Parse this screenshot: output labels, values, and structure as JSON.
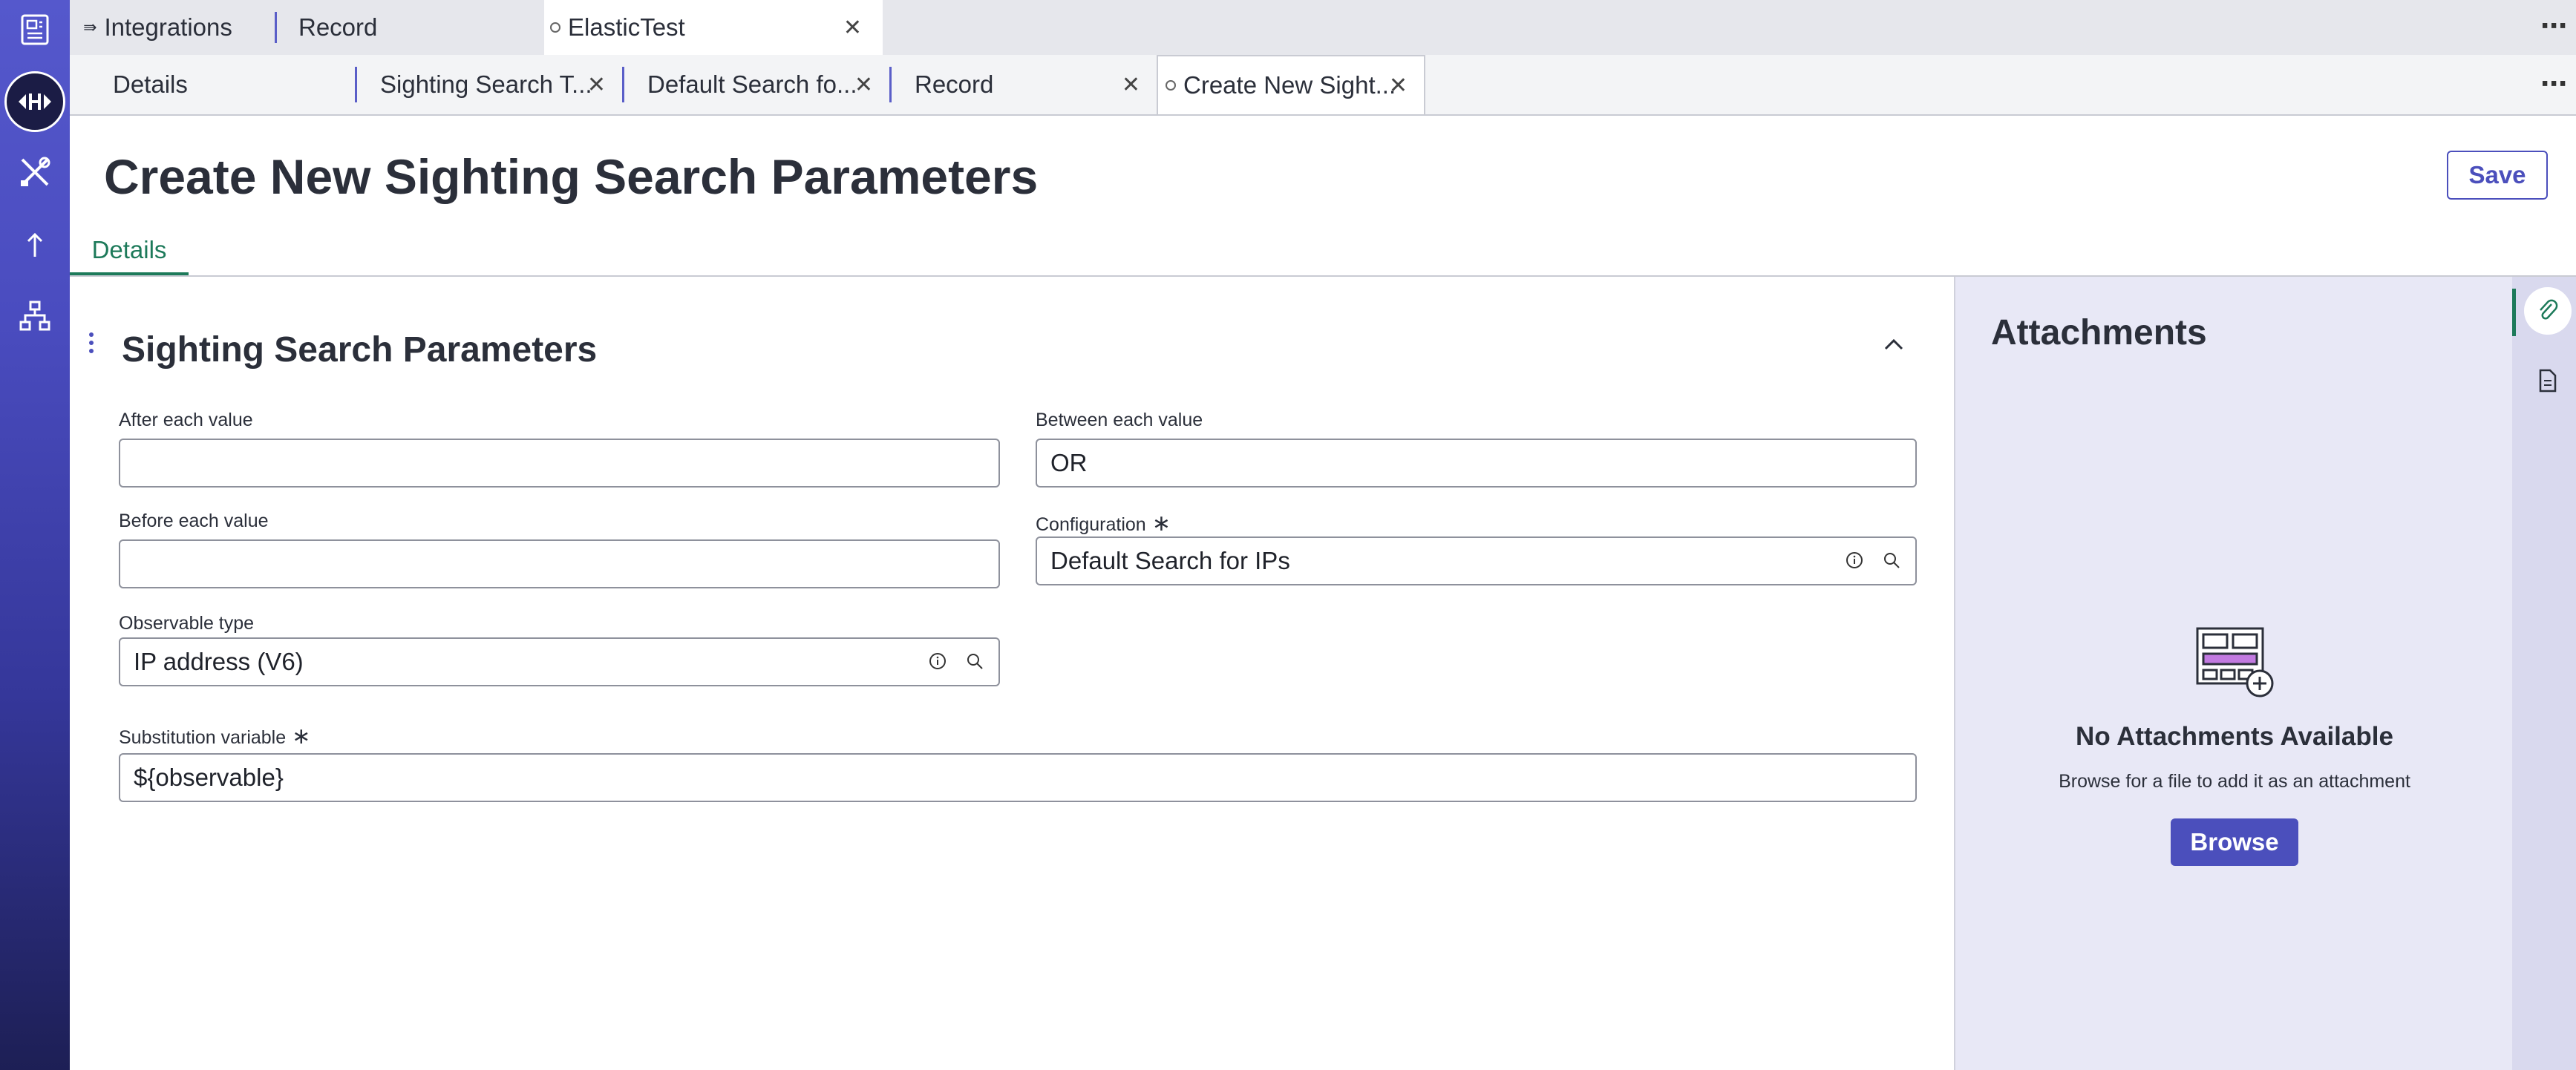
{
  "window_tabs": [
    {
      "label": "Integrations",
      "icon": "integration-icon"
    },
    {
      "label": "Record"
    },
    {
      "label": "ElasticTest",
      "active": true
    }
  ],
  "record_tabs": [
    {
      "label": "Details"
    },
    {
      "label": "Sighting Search T..."
    },
    {
      "label": "Default Search fo..."
    },
    {
      "label": "Record"
    },
    {
      "label": "Create New Sight...",
      "active": true
    }
  ],
  "page": {
    "title": "Create New Sighting Search Parameters",
    "save_label": "Save",
    "details_tab": "Details"
  },
  "section": {
    "title": "Sighting Search Parameters"
  },
  "fields": {
    "after_each_value": {
      "label": "After each value",
      "value": ""
    },
    "between_each_value": {
      "label": "Between each value",
      "value": "OR"
    },
    "before_each_value": {
      "label": "Before each value",
      "value": ""
    },
    "configuration": {
      "label": "Configuration",
      "value": "Default Search for IPs",
      "required_mark": "∗"
    },
    "observable_type": {
      "label": "Observable type",
      "value": "IP address (V6)"
    },
    "substitution_variable": {
      "label": "Substitution variable",
      "value": "${observable}",
      "required_mark": "∗"
    }
  },
  "attachments": {
    "title": "Attachments",
    "empty_title": "No Attachments Available",
    "empty_hint": "Browse for a file to add it as an attachment",
    "browse_label": "Browse"
  },
  "colors": {
    "accent": "#4b4fbc",
    "tab_active": "#1d7a5a",
    "rail_top": "#5558cc",
    "rail_bottom": "#1d1f55"
  }
}
